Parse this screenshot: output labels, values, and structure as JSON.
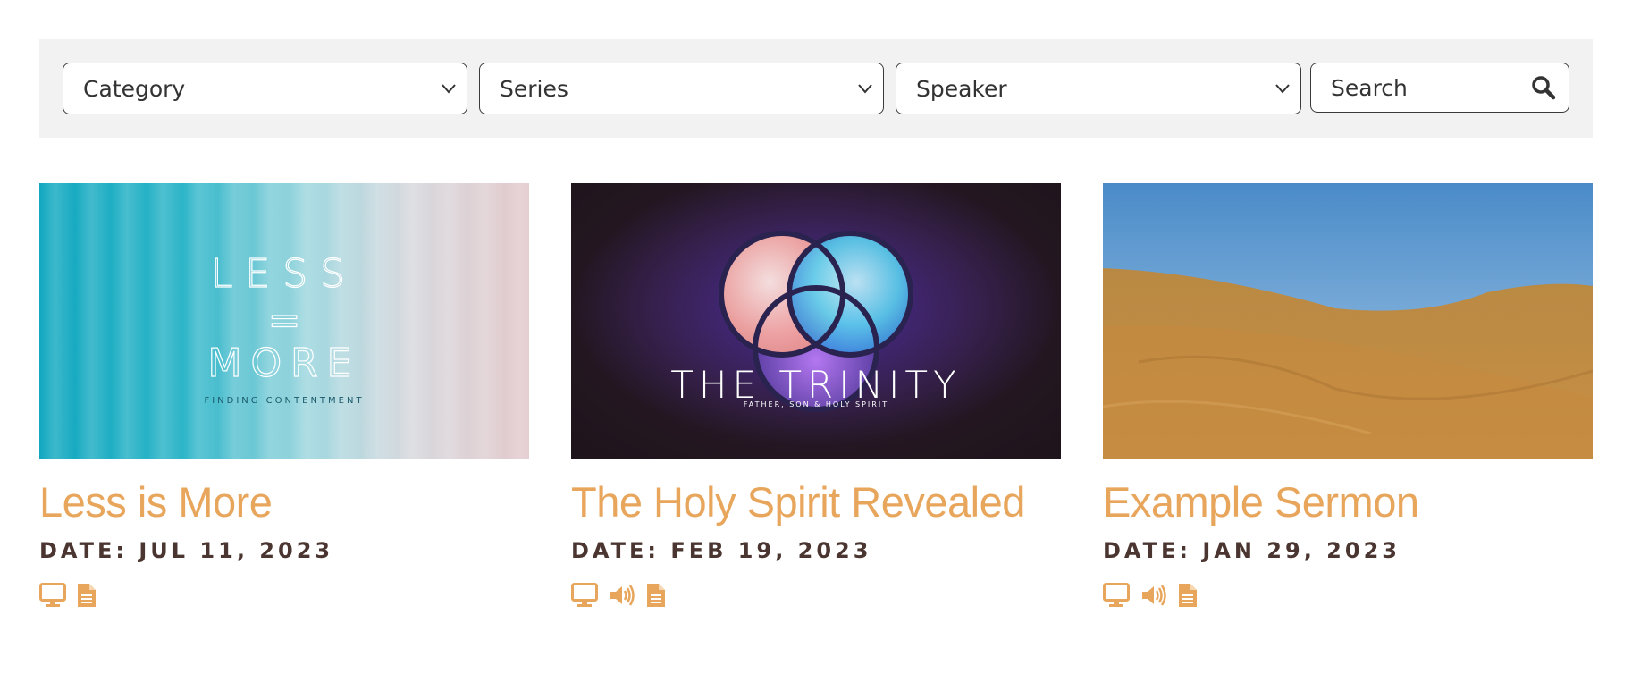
{
  "filters": {
    "category_label": "Category",
    "series_label": "Series",
    "speaker_label": "Speaker",
    "search_placeholder": "Search"
  },
  "accent_color": "#e8a65c",
  "date_color": "#4a3530",
  "sermons": [
    {
      "title": "Less is More",
      "date": "DATE: JUL 11, 2023",
      "thumb_text": {
        "line1": "LESS",
        "line2": "=",
        "line3": "MORE",
        "subtitle": "FINDING CONTENTMENT"
      },
      "media_icons": [
        "video-icon",
        "notes-icon"
      ]
    },
    {
      "title": "The Holy Spirit Revealed",
      "date": "DATE: FEB 19, 2023",
      "thumb_text": {
        "title": "THE TRINITY",
        "subtitle": "FATHER, SON & HOLY SPIRIT"
      },
      "media_icons": [
        "video-icon",
        "audio-icon",
        "notes-icon"
      ]
    },
    {
      "title": "Example Sermon",
      "date": "DATE: JAN 29, 2023",
      "media_icons": [
        "video-icon",
        "audio-icon",
        "notes-icon"
      ]
    }
  ]
}
